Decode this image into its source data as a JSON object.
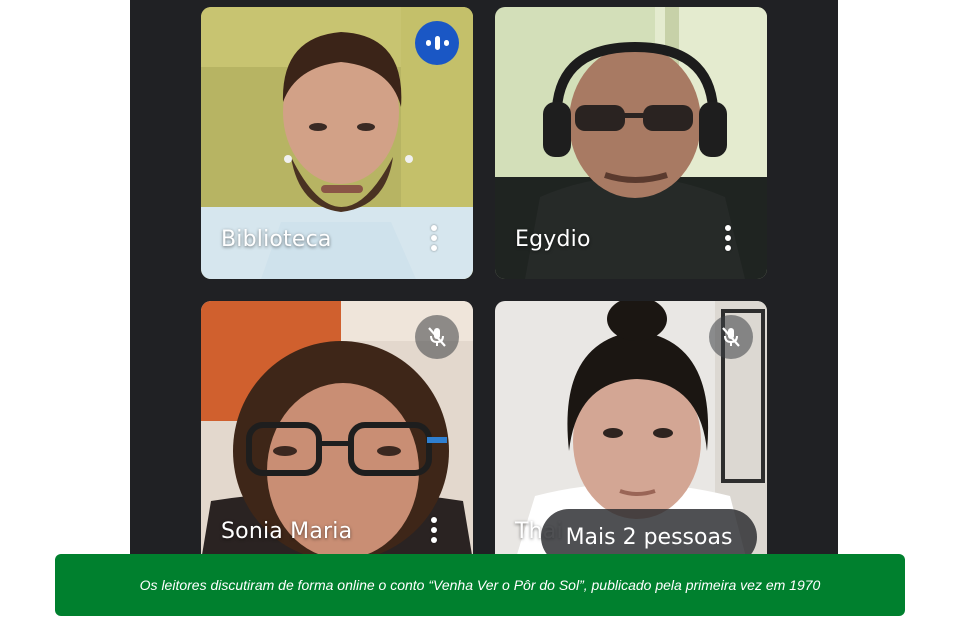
{
  "meeting": {
    "participants": [
      {
        "name": "Biblioteca",
        "status": "speaking"
      },
      {
        "name": "Egydio",
        "status": "unmuted"
      },
      {
        "name": "Sonia Maria",
        "status": "muted"
      },
      {
        "name": "Thai",
        "status": "muted"
      }
    ],
    "more_people_label": "Mais 2 pessoas",
    "icons": {
      "speaking": "audio-level-icon",
      "muted": "mic-off-icon",
      "options": "more-vert-icon"
    }
  },
  "caption": {
    "text": "Os leitores discutiram de forma online o conto “Venha Ver o Pôr do Sol”, publicado pela primeira vez em 1970"
  },
  "colors": {
    "meet_background": "#202124",
    "speaking_indicator": "#1a57c5",
    "caption_background": "#00802e"
  }
}
